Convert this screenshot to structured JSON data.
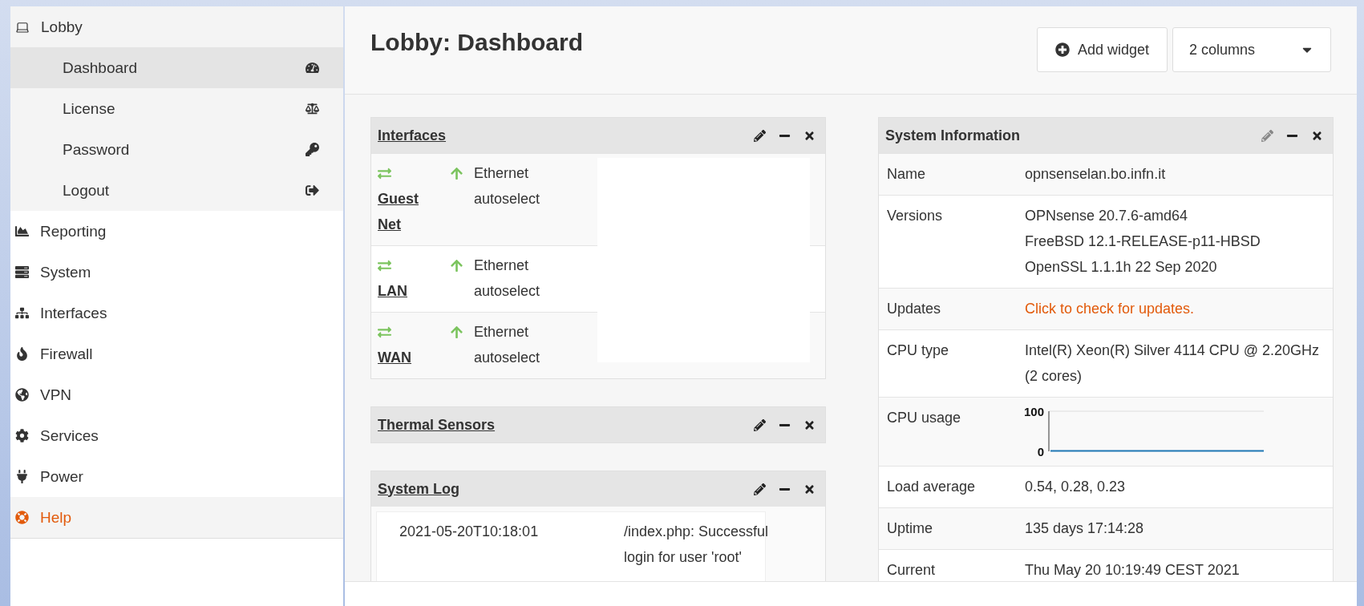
{
  "sidebar": {
    "items": [
      {
        "label": "Lobby",
        "expanded": true,
        "highlighted": false,
        "children": [
          {
            "label": "Dashboard",
            "selected": true
          },
          {
            "label": "License",
            "selected": false
          },
          {
            "label": "Password",
            "selected": false
          },
          {
            "label": "Logout",
            "selected": false
          }
        ]
      },
      {
        "label": "Reporting",
        "expanded": false,
        "highlighted": false
      },
      {
        "label": "System",
        "expanded": false,
        "highlighted": false
      },
      {
        "label": "Interfaces",
        "expanded": false,
        "highlighted": false
      },
      {
        "label": "Firewall",
        "expanded": false,
        "highlighted": false
      },
      {
        "label": "VPN",
        "expanded": false,
        "highlighted": false
      },
      {
        "label": "Services",
        "expanded": false,
        "highlighted": false
      },
      {
        "label": "Power",
        "expanded": false,
        "highlighted": false
      },
      {
        "label": "Help",
        "expanded": false,
        "highlighted": true
      }
    ]
  },
  "page": {
    "title": "Lobby: Dashboard",
    "add_widget": "Add widget",
    "columns_select": {
      "value": "2 columns"
    }
  },
  "widgets_left": [
    {
      "kind": "interfaces",
      "title": "Interfaces",
      "rows": [
        {
          "name": "Guest Net",
          "media": "Ethernet autoselect"
        },
        {
          "name": "LAN",
          "media": "Ethernet autoselect"
        },
        {
          "name": "WAN",
          "media": "Ethernet autoselect"
        }
      ]
    },
    {
      "kind": "empty",
      "title": "Thermal Sensors"
    },
    {
      "kind": "log",
      "title": "System Log",
      "rows": [
        {
          "time": "2021-05-20T10:18:01",
          "message": "/index.php: Successful login for user 'root'"
        }
      ]
    }
  ],
  "widgets_right": [
    {
      "kind": "info",
      "title": "System Information",
      "rows": [
        {
          "kind": "text",
          "label": "Name",
          "lines": [
            "opnsenselan.bo.infn.it"
          ]
        },
        {
          "kind": "text",
          "label": "Versions",
          "lines": [
            "OPNsense 20.7.6-amd64",
            "FreeBSD 12.1-RELEASE-p11-HBSD",
            "OpenSSL 1.1.1h 22 Sep 2020"
          ]
        },
        {
          "kind": "link",
          "label": "Updates",
          "lines": [
            "Click to check for updates."
          ]
        },
        {
          "kind": "text",
          "label": "CPU type",
          "lines": [
            "Intel(R) Xeon(R) Silver 4114 CPU @ 2.20GHz (2 cores)"
          ]
        },
        {
          "kind": "chart",
          "label": "CPU usage",
          "chart_data": {
            "type": "line",
            "ylim": [
              0,
              100
            ],
            "yticks": [
              0,
              100
            ],
            "series": [
              {
                "color": "#1f77b4",
                "values": [
                  1,
                  1,
                  1,
                  1,
                  1,
                  1,
                  1,
                  1,
                  1,
                  1,
                  1,
                  1
                ]
              }
            ]
          }
        },
        {
          "kind": "text",
          "label": "Load average",
          "lines": [
            "0.54, 0.28, 0.23"
          ]
        },
        {
          "kind": "text",
          "label": "Uptime",
          "lines": [
            "135 days 17:14:28"
          ]
        },
        {
          "kind": "text",
          "label": "Current",
          "lines": [
            "Thu May 20 10:19:49 CEST 2021"
          ]
        }
      ]
    }
  ]
}
